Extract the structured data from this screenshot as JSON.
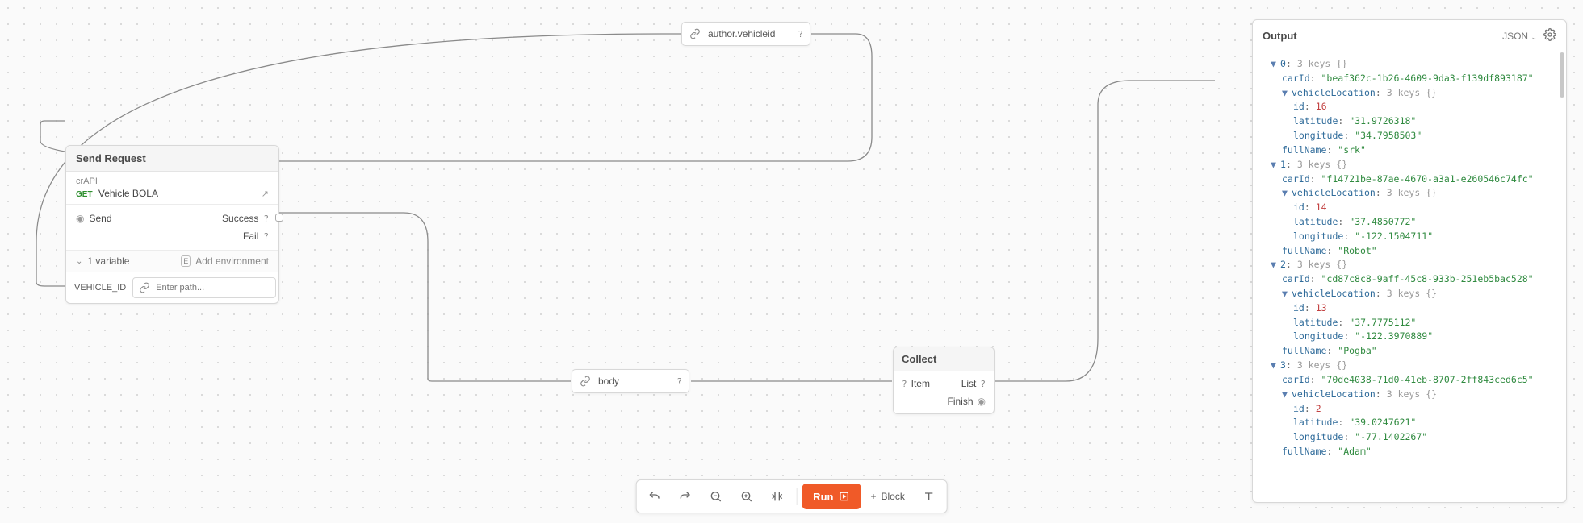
{
  "pipe_author": {
    "text": "author.vehicleid"
  },
  "pipe_body": {
    "text": "body"
  },
  "send_request": {
    "title": "Send Request",
    "sourceLabel": "crAPI",
    "method": "GET",
    "reqName": "Vehicle BOLA",
    "port_send": "Send",
    "port_success": "Success",
    "port_fail": "Fail",
    "vars_summary": "1 variable",
    "add_env": "Add environment",
    "var_name": "VEHICLE_ID",
    "var_placeholder": "Enter path..."
  },
  "collect": {
    "title": "Collect",
    "item": "Item",
    "list": "List",
    "finish": "Finish"
  },
  "output": {
    "title": "Output",
    "viewMode": "JSON",
    "count_meta": "3 keys",
    "items": [
      {
        "carId": "beaf362c-1b26-4609-9da3-f139df893187",
        "vehicleLocation": {
          "id": 16,
          "latitude": "31.9726318",
          "longitude": "34.7958503"
        },
        "fullName": "srk"
      },
      {
        "carId": "f14721be-87ae-4670-a3a1-e260546c74fc",
        "vehicleLocation": {
          "id": 14,
          "latitude": "37.4850772",
          "longitude": "-122.1504711"
        },
        "fullName": "Robot"
      },
      {
        "carId": "cd87c8c8-9aff-45c8-933b-251eb5bac528",
        "vehicleLocation": {
          "id": 13,
          "latitude": "37.7775112",
          "longitude": "-122.3970889"
        },
        "fullName": "Pogba"
      },
      {
        "carId": "70de4038-71d0-41eb-8707-2ff843ced6c5",
        "vehicleLocation": {
          "id": 2,
          "latitude": "39.0247621",
          "longitude": "-77.1402267"
        },
        "fullName": "Adam"
      }
    ]
  },
  "toolbar": {
    "run": "Run",
    "block": "Block"
  }
}
